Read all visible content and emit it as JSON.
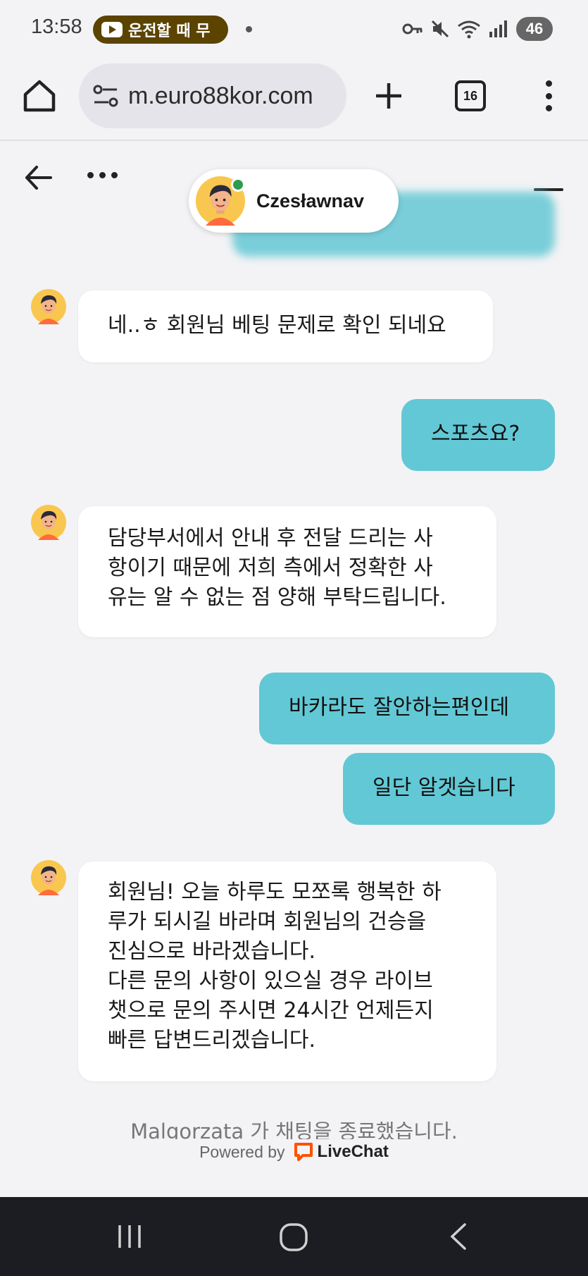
{
  "status_bar": {
    "time": "13:58",
    "notification_text": "운전할 때 무",
    "battery": "46"
  },
  "browser": {
    "url": "m.euro88kor.com",
    "tab_count": "16"
  },
  "chat": {
    "agent_name": "Czesławnav",
    "messages": [
      {
        "from": "agent",
        "text": "네..ㅎ 회원님 베팅 문제로 확인 되네요"
      },
      {
        "from": "visitor",
        "text": "스포츠요?"
      },
      {
        "from": "agent",
        "text": "담당부서에서 안내 후 전달 드리는 사\n항이기 때문에 저희 측에서 정확한 사\n유는 알 수 없는 점 양해 부탁드립니다."
      },
      {
        "from": "visitor",
        "text": "바카라도 잘안하는편인데"
      },
      {
        "from": "visitor",
        "text": "일단 알겟습니다"
      },
      {
        "from": "agent",
        "text": "회원님! 오늘 하루도 모쪼록 행복한 하\n루가 되시길 바라며 회원님의 건승을\n진심으로 바라겠습니다.\n다른 문의 사항이 있으실 경우 라이브\n챗으로 문의 주시면 24시간 언제든지\n빠른 답변드리겠습니다."
      }
    ],
    "system_message": "Malgorzata 가 채팅을 종료했습니다.",
    "powered_by": "Powered by",
    "brand": "LiveChat"
  },
  "colors": {
    "visitor_bubble": "#62c8d5",
    "agent_bubble": "#ffffff",
    "background": "#f3f3f5",
    "livechat_orange": "#ff5100",
    "online": "#2e9b4f"
  }
}
